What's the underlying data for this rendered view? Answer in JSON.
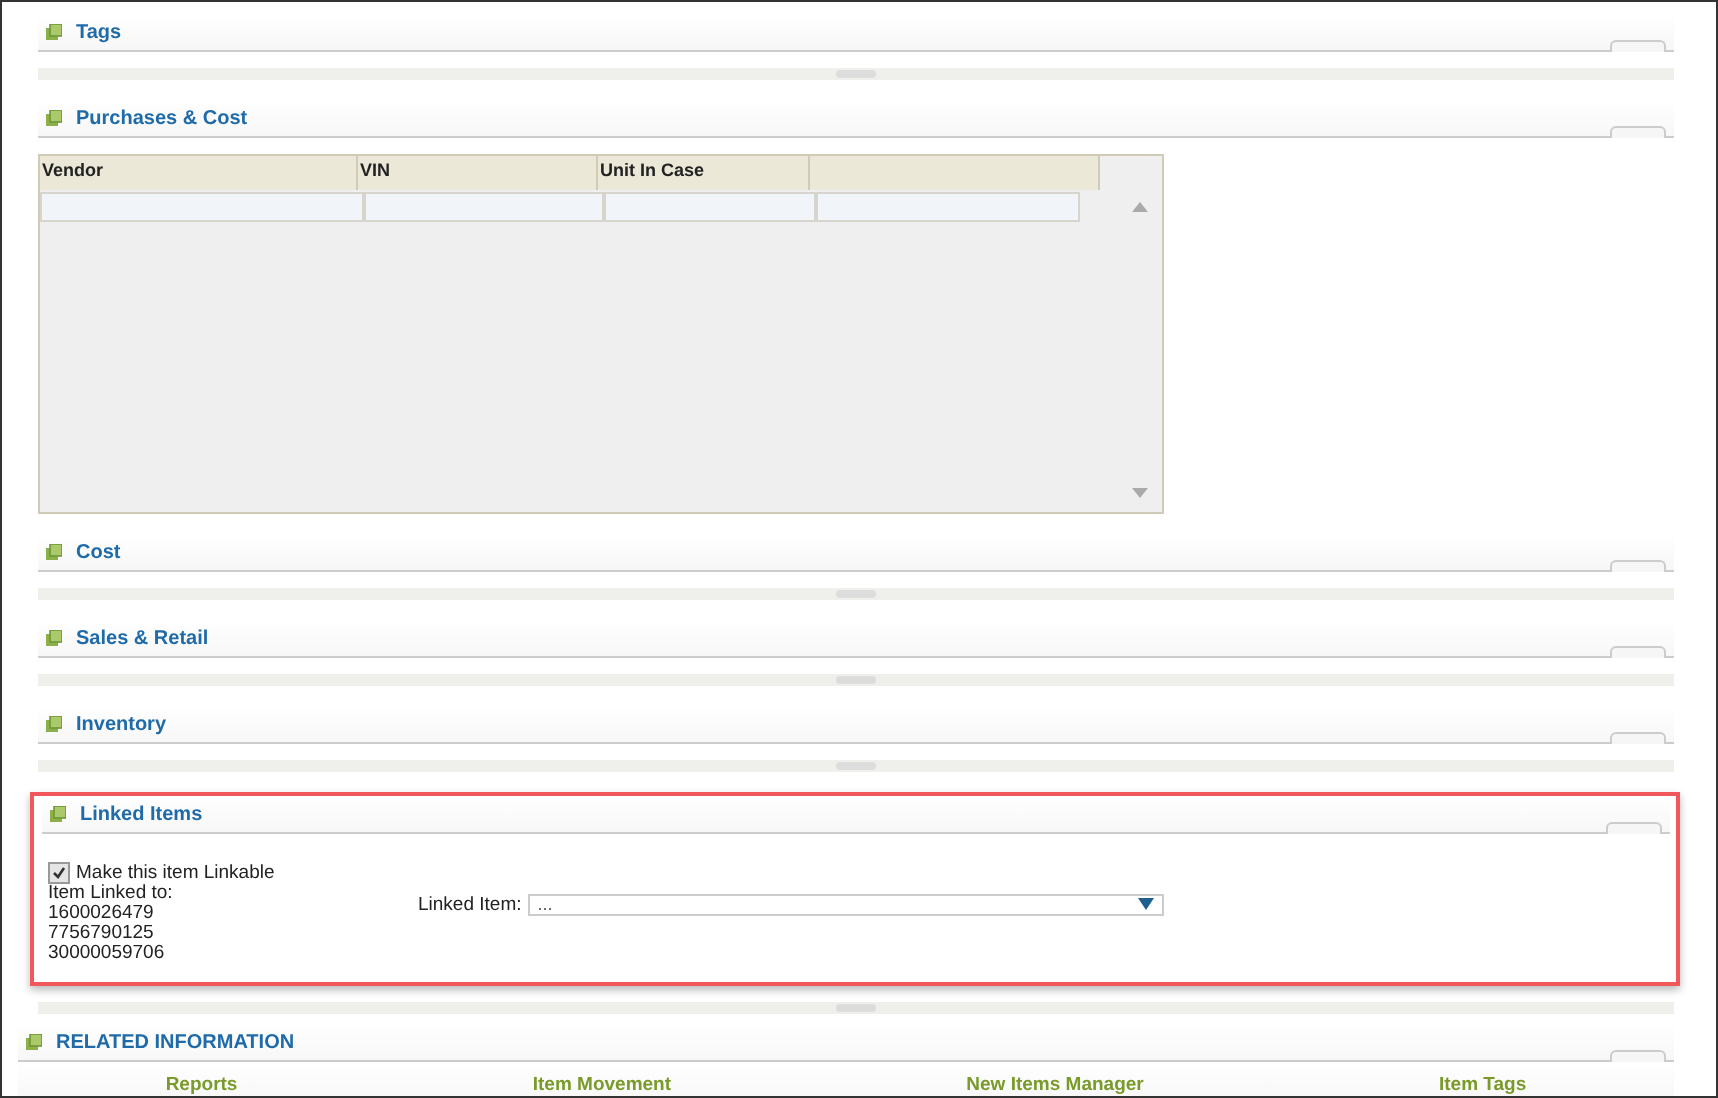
{
  "sections": [
    {
      "kind": "plain",
      "title": "Tags"
    },
    {
      "kind": "table",
      "title": "Purchases & Cost",
      "columns": [
        "Vendor",
        "VIN",
        "Unit In Case"
      ]
    },
    {
      "kind": "plain",
      "title": "Cost"
    },
    {
      "kind": "plain",
      "title": "Sales & Retail"
    },
    {
      "kind": "plain",
      "title": "Inventory"
    },
    {
      "kind": "linked",
      "title": "Linked Items",
      "linkable_label": "Make this item Linkable",
      "linkable_checked": true,
      "linked_to_label": "Item Linked to:",
      "linked_ids": [
        "1600026479",
        "7756790125",
        "30000059706"
      ],
      "select_label": "Linked Item:",
      "select_value": "..."
    }
  ],
  "related": {
    "title": "RELATED INFORMATION",
    "links": [
      "Reports",
      "Item Movement",
      "New Items Manager",
      "Item Tags"
    ]
  }
}
